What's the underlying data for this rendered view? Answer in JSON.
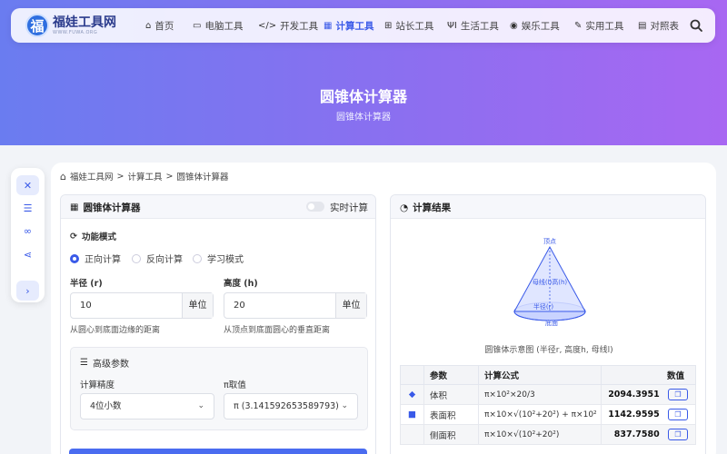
{
  "site": {
    "name": "福娃工具网",
    "sub": "WWW.FUWA.ORG",
    "logo_char": "福"
  },
  "nav": [
    {
      "icon": "home-icon",
      "glyph": "⌂",
      "label": "首页"
    },
    {
      "icon": "desktop-icon",
      "glyph": "▭",
      "label": "电脑工具"
    },
    {
      "icon": "code-icon",
      "glyph": "</>",
      "label": "开发工具"
    },
    {
      "icon": "calculator-icon",
      "glyph": "▦",
      "label": "计算工具"
    },
    {
      "icon": "sitemap-icon",
      "glyph": "⊞",
      "label": "站长工具"
    },
    {
      "icon": "utensils-icon",
      "glyph": "ΨΙ",
      "label": "生活工具"
    },
    {
      "icon": "gamepad-icon",
      "glyph": "◉",
      "label": "娱乐工具"
    },
    {
      "icon": "wrench-icon",
      "glyph": "✎",
      "label": "实用工具"
    },
    {
      "icon": "table-icon",
      "glyph": "▤",
      "label": "对照表"
    }
  ],
  "hero": {
    "title": "圆锥体计算器",
    "subtitle": "圆锥体计算器"
  },
  "breadcrumb": {
    "home": "福娃工具网",
    "sep1": ">",
    "cat": "计算工具",
    "sep2": ">",
    "page": "圆锥体计算器"
  },
  "calculator": {
    "title": "圆锥体计算器",
    "realtime_label": "实时计算",
    "mode_label": "功能模式",
    "modes": [
      "正向计算",
      "反向计算",
      "学习模式"
    ],
    "radius": {
      "label": "半径 (r)",
      "value": "10",
      "unit": "单位",
      "hint": "从圆心到底面边缘的距离"
    },
    "height": {
      "label": "高度 (h)",
      "value": "20",
      "unit": "单位",
      "hint": "从顶点到底面圆心的垂直距离"
    },
    "advanced": {
      "title": "高级参数",
      "precision_label": "计算精度",
      "precision_value": "4位小数",
      "pi_label": "π取值",
      "pi_value": "π (3.141592653589793)"
    }
  },
  "result": {
    "title": "计算结果",
    "diagram": {
      "apex": "顶点",
      "slant": "母线(l)高(h)",
      "radius": "半径(r)",
      "base": "底面",
      "caption": "圆锥体示意图 (半径r, 高度h, 母线l)"
    },
    "headers": [
      "参数",
      "计算公式",
      "数值"
    ],
    "rows": [
      {
        "icon": "cube-icon",
        "glyph": "◆",
        "name": "体积",
        "formula": "π×10²×20/3",
        "value": "2094.3951"
      },
      {
        "icon": "square-icon",
        "glyph": "■",
        "name": "表面积",
        "formula": "π×10×√(10²+20²) + π×10²",
        "value": "1142.9595"
      },
      {
        "icon": "",
        "glyph": "",
        "name": "侧面积",
        "formula": "π×10×√(10²+20²)",
        "value": "837.7580"
      }
    ]
  },
  "colors": {
    "accent": "#3a5ae8",
    "hero_start": "#6a7cf0",
    "hero_end": "#a867f2"
  }
}
